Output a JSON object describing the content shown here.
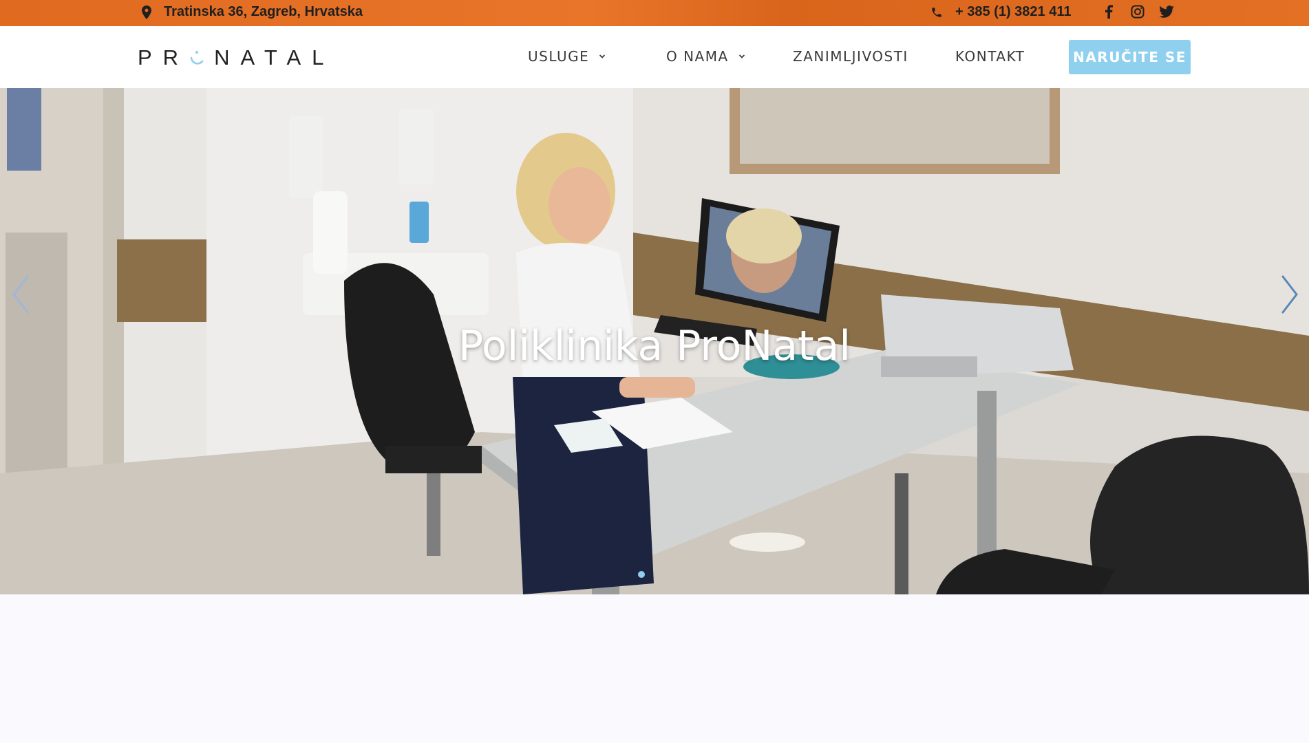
{
  "topbar": {
    "address": "Tratinska 36, Zagreb, Hrvatska",
    "phone": "+ 385 (1) 3821 411",
    "icons": [
      "location-icon",
      "phone-icon",
      "facebook-icon",
      "instagram-icon",
      "twitter-icon"
    ]
  },
  "header": {
    "logo_text": "PRONATAL",
    "logo_left": "PR",
    "logo_right": "NATAL",
    "nav": {
      "usluge": "USLUGE",
      "o_nama": "O NAMA",
      "zanimljivosti": "ZANIMLJIVOSTI",
      "kontakt": "KONTAKT"
    },
    "cta_label": "NARUČITE SE"
  },
  "hero": {
    "title": "Poliklinika ProNatal",
    "active_slide": 1,
    "slide_count": 1
  },
  "colors": {
    "topbar": "#e06a20",
    "accent": "#8fd0ee",
    "text": "#3a3a3a",
    "background": "#f9f9fe"
  }
}
